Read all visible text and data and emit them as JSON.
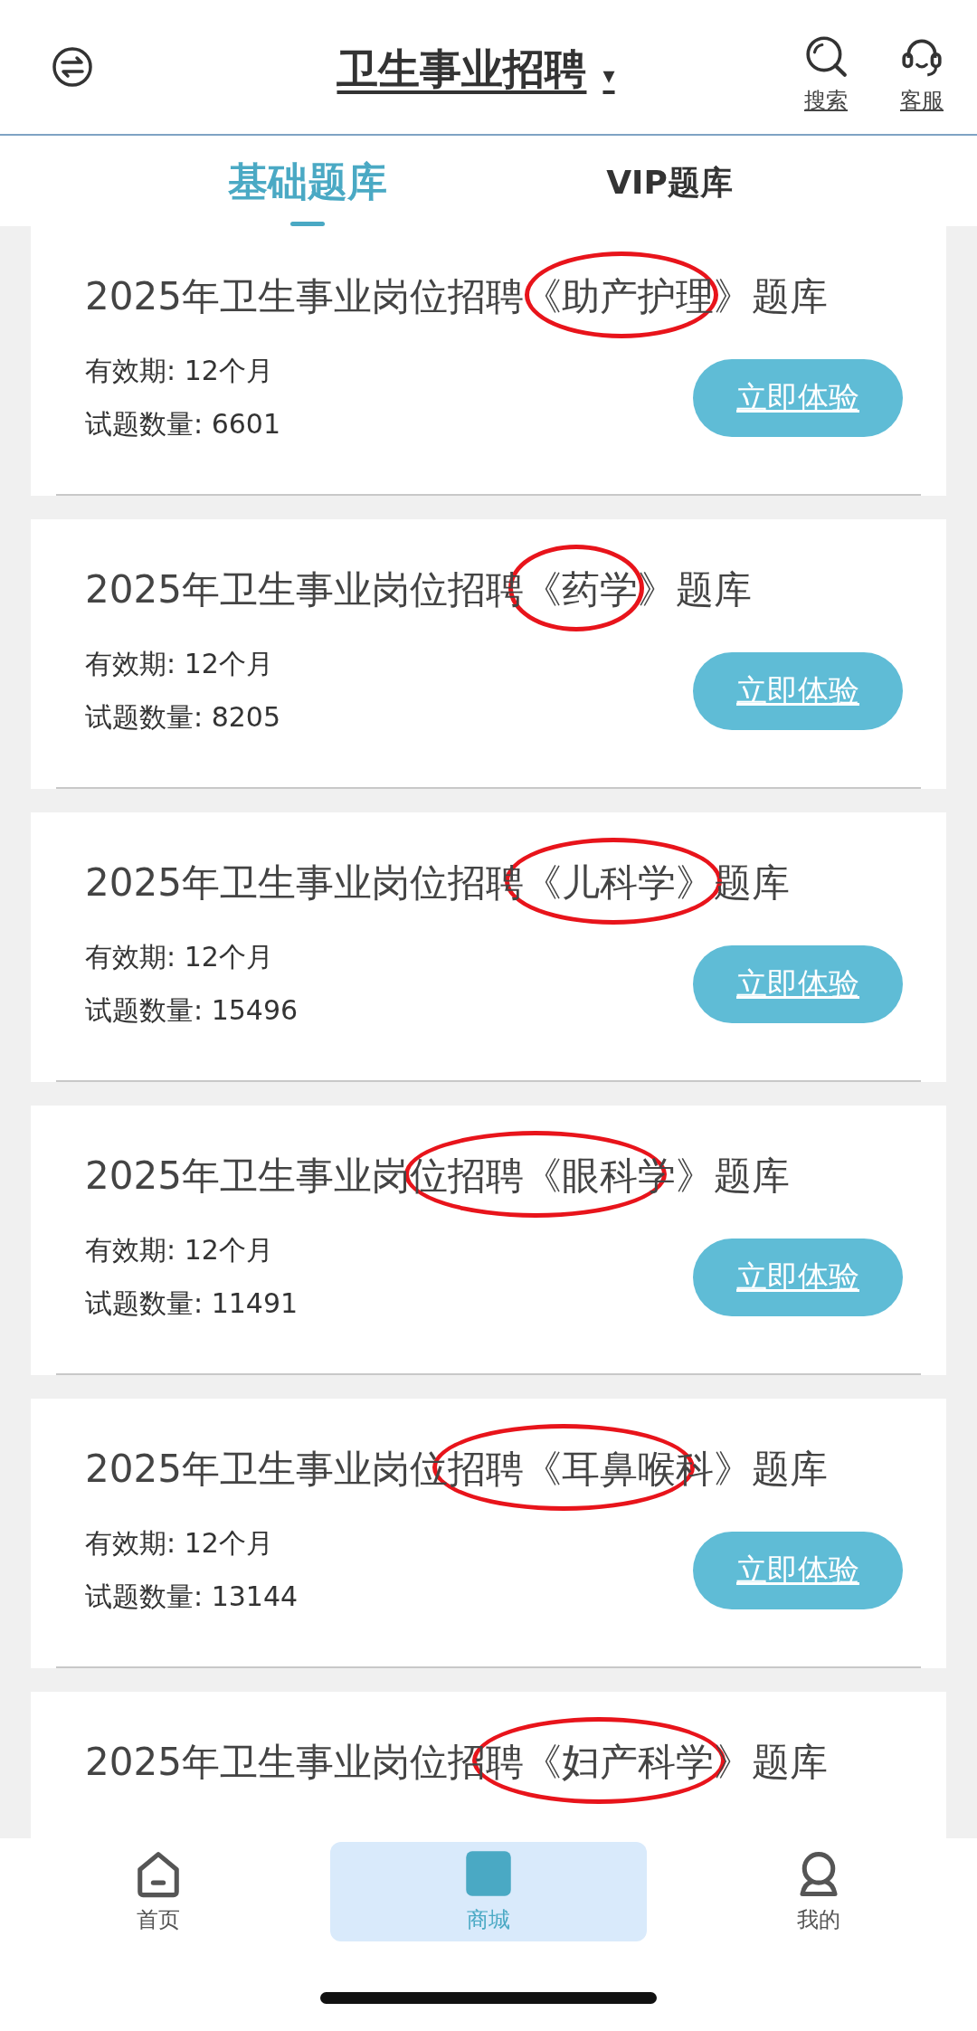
{
  "header": {
    "title": "卫生事业招聘",
    "caret": "▾",
    "actions": [
      {
        "kind": "search",
        "label": "搜索"
      },
      {
        "kind": "service",
        "label": "客服"
      }
    ]
  },
  "tabs": [
    {
      "label": "基础题库",
      "selected": true
    },
    {
      "label": "VIP题库",
      "selected": false
    }
  ],
  "cards": [
    {
      "title": "2025年卫生事业岗位招聘《助产护理》题库",
      "validity": "有效期: 12个月",
      "count": "试题数量: 6601",
      "button": "立即体验",
      "circled": true
    },
    {
      "title": "2025年卫生事业岗位招聘《药学》题库",
      "validity": "有效期: 12个月",
      "count": "试题数量: 8205",
      "button": "立即体验",
      "circled": true
    },
    {
      "title": "2025年卫生事业岗位招聘《儿科学》题库",
      "validity": "有效期: 12个月",
      "count": "试题数量: 15496",
      "button": "立即体验",
      "circled": true
    },
    {
      "title": "2025年卫生事业岗位招聘《眼科学》题库",
      "validity": "有效期: 12个月",
      "count": "试题数量: 11491",
      "button": "立即体验",
      "circled": true
    },
    {
      "title": "2025年卫生事业岗位招聘《耳鼻喉科》题库",
      "validity": "有效期: 12个月",
      "count": "试题数量: 13144",
      "button": "立即体验",
      "circled": true
    },
    {
      "title": "2025年卫生事业岗位招聘《妇产科学》题库",
      "circled": true
    }
  ],
  "bottom_nav": [
    {
      "kind": "home",
      "label": "首页",
      "selected": false
    },
    {
      "kind": "shop",
      "label": "商城",
      "selected": true
    },
    {
      "kind": "me",
      "label": "我的",
      "selected": false
    }
  ]
}
